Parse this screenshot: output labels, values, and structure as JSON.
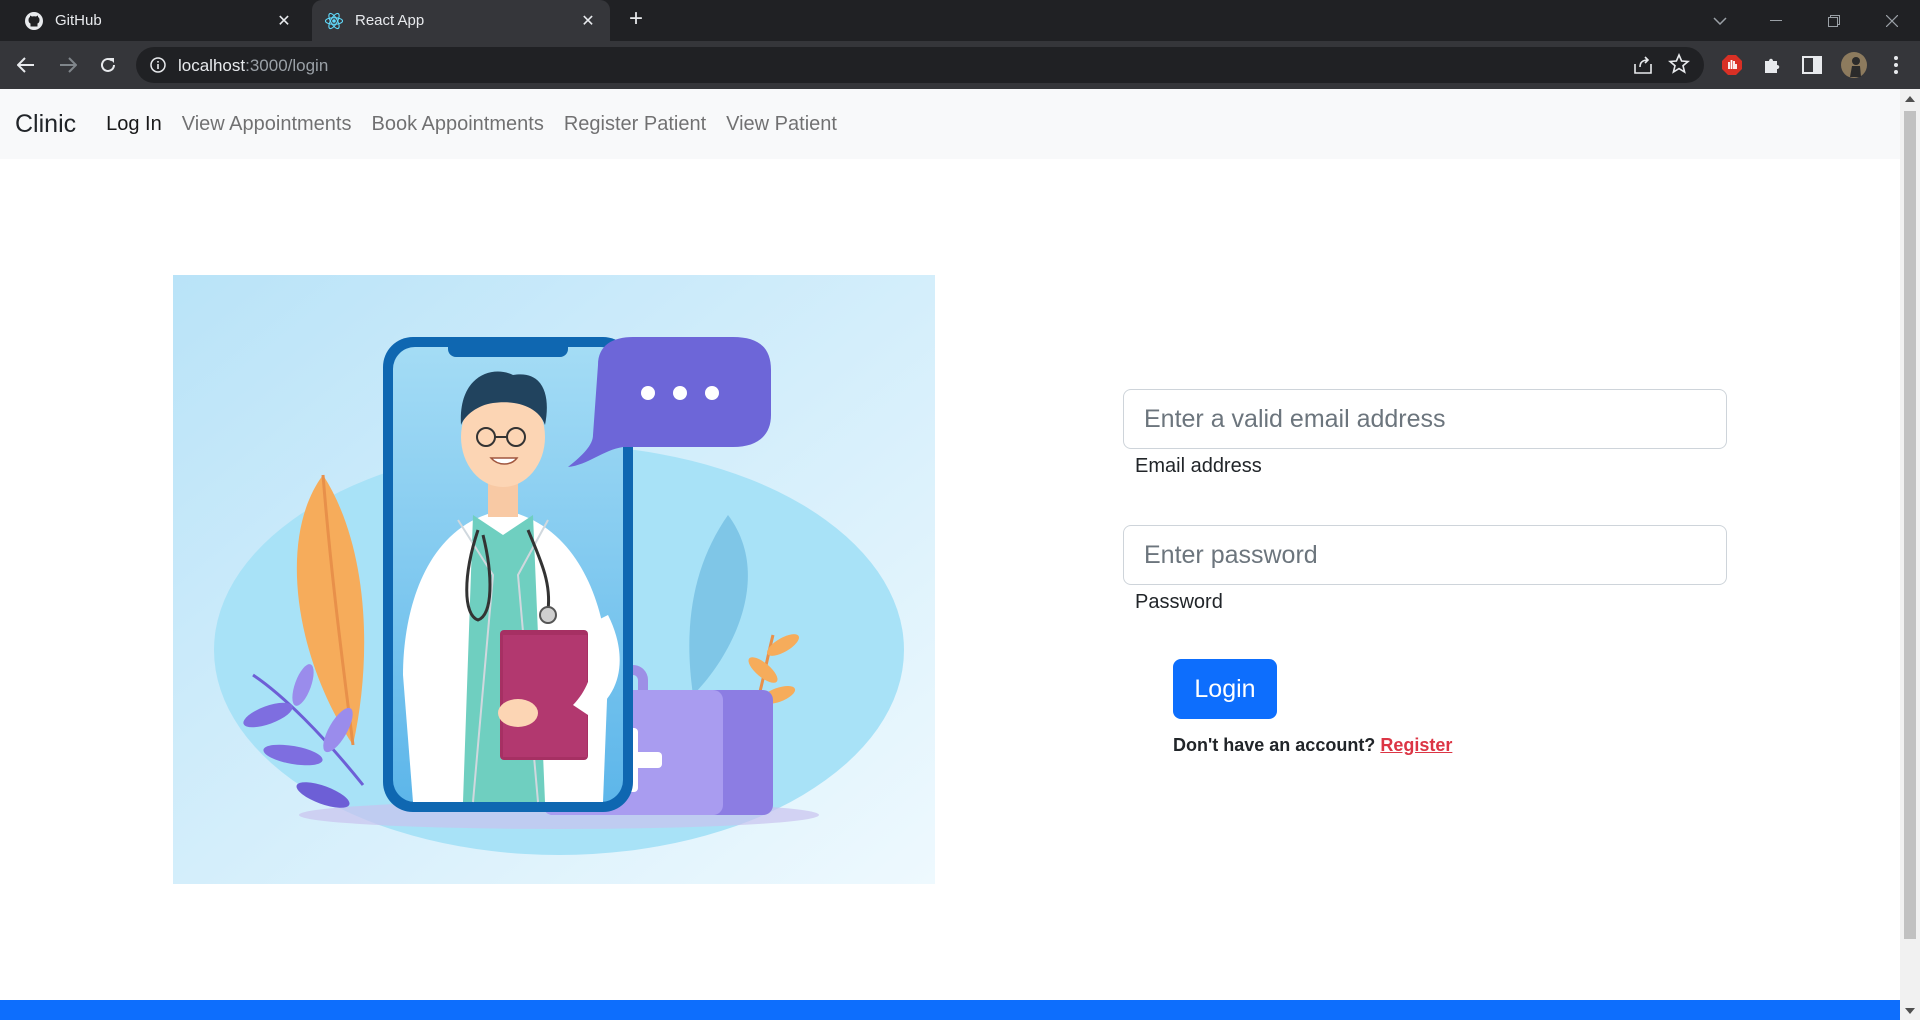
{
  "browser": {
    "tabs": [
      {
        "title": "GitHub",
        "icon": "github-icon"
      },
      {
        "title": "React App",
        "icon": "react-icon"
      }
    ],
    "url_host": "localhost",
    "url_rest": ":3000/login"
  },
  "navbar": {
    "brand": "Clinic",
    "links": [
      "Log In",
      "View Appointments",
      "Book Appointments",
      "Register Patient",
      "View Patient"
    ]
  },
  "login_form": {
    "email_placeholder": "Enter a valid email address",
    "email_label": "Email address",
    "password_placeholder": "Enter password",
    "password_label": "Password",
    "login_button": "Login",
    "register_prompt": "Don't have an account?",
    "register_link": "Register"
  },
  "colors": {
    "primary": "#0d6efd",
    "danger": "#dc3545",
    "navbar_bg": "#f8f9fa"
  }
}
